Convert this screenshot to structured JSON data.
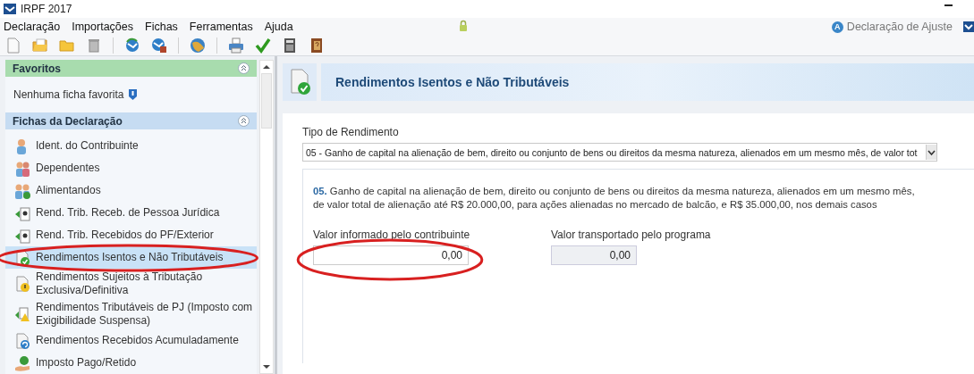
{
  "window": {
    "title": "IRPF 2017"
  },
  "menu": [
    {
      "label": "Declaração"
    },
    {
      "label": "Importações"
    },
    {
      "label": "Fichas"
    },
    {
      "label": "Ferramentas"
    },
    {
      "label": "Ajuda"
    }
  ],
  "mode": {
    "label": "Declaração de Ajuste",
    "badge": "A"
  },
  "sidebar": {
    "favorites": {
      "title": "Favoritos",
      "expanded": true,
      "empty_text": "Nenhuma ficha favorita"
    },
    "fichas": {
      "title": "Fichas da Declaração",
      "expanded": true,
      "items": [
        {
          "label": "Ident. do Contribuinte",
          "kind": "person",
          "selected": false
        },
        {
          "label": "Dependentes",
          "kind": "people",
          "selected": false
        },
        {
          "label": "Alimentandos",
          "kind": "family",
          "selected": false
        },
        {
          "label": "Rend. Trib. Receb. de Pessoa Jurídica",
          "kind": "income",
          "selected": false
        },
        {
          "label": "Rend. Trib. Recebidos do PF/Exterior",
          "kind": "income",
          "selected": false
        },
        {
          "label": "Rendimentos Isentos e Não Tributáveis",
          "kind": "doc-check",
          "selected": true
        },
        {
          "label": "Rendimentos Sujeitos à Tributação Exclusiva/Definitiva",
          "kind": "doc-warning",
          "selected": false
        },
        {
          "label": "Rendimentos Tributáveis de PJ (Imposto com Exigibilidade Suspensa)",
          "kind": "income-warning",
          "selected": false
        },
        {
          "label": "Rendimentos Recebidos Acumuladamente",
          "kind": "doc-refresh",
          "selected": false
        },
        {
          "label": "Imposto Pago/Retido",
          "kind": "money",
          "selected": false
        }
      ]
    }
  },
  "content": {
    "title": "Rendimentos Isentos e Não Tributáveis",
    "tipo": {
      "label": "Tipo de Rendimento",
      "value": "05 - Ganho de capital na alienação de bem, direito ou conjunto de bens ou direitos da mesma natureza, alienados em um mesmo mês, de valor tot"
    },
    "description": "**05.** Ganho de capital na alienação de bem, direito ou conjunto de bens ou direitos da mesma natureza, alienados em um mesmo mês, de valor total de alienação até R$ 20.000,00, para ações alienadas no mercado de balcão, e R$ 35.000,00, nos demais casos",
    "fields": [
      {
        "label": "Valor informado pelo contribuinte",
        "value": "0,00",
        "disabled": false
      },
      {
        "label": "Valor transportado pelo programa",
        "value": "0,00",
        "disabled": true
      }
    ]
  }
}
